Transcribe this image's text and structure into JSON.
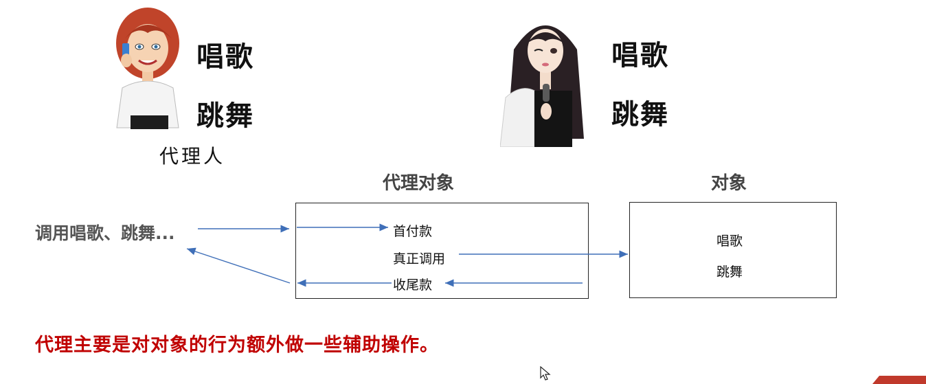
{
  "agent": {
    "skill_sing": "唱歌",
    "skill_dance": "跳舞",
    "caption": "代理人"
  },
  "star": {
    "skill_sing": "唱歌",
    "skill_dance": "跳舞"
  },
  "proxy_box": {
    "title": "代理对象",
    "step_1": "首付款",
    "step_2": "真正调用",
    "step_3": "收尾款"
  },
  "target_box": {
    "title": "对象",
    "item_1": "唱歌",
    "item_2": "跳舞"
  },
  "caller": {
    "label": "调用唱歌、跳舞..."
  },
  "summary": "代理主要是对对象的行为额外做一些辅助操作。",
  "colors": {
    "arrow": "#3f6fb8",
    "summary": "#c00000",
    "corner": "#c0392b"
  }
}
